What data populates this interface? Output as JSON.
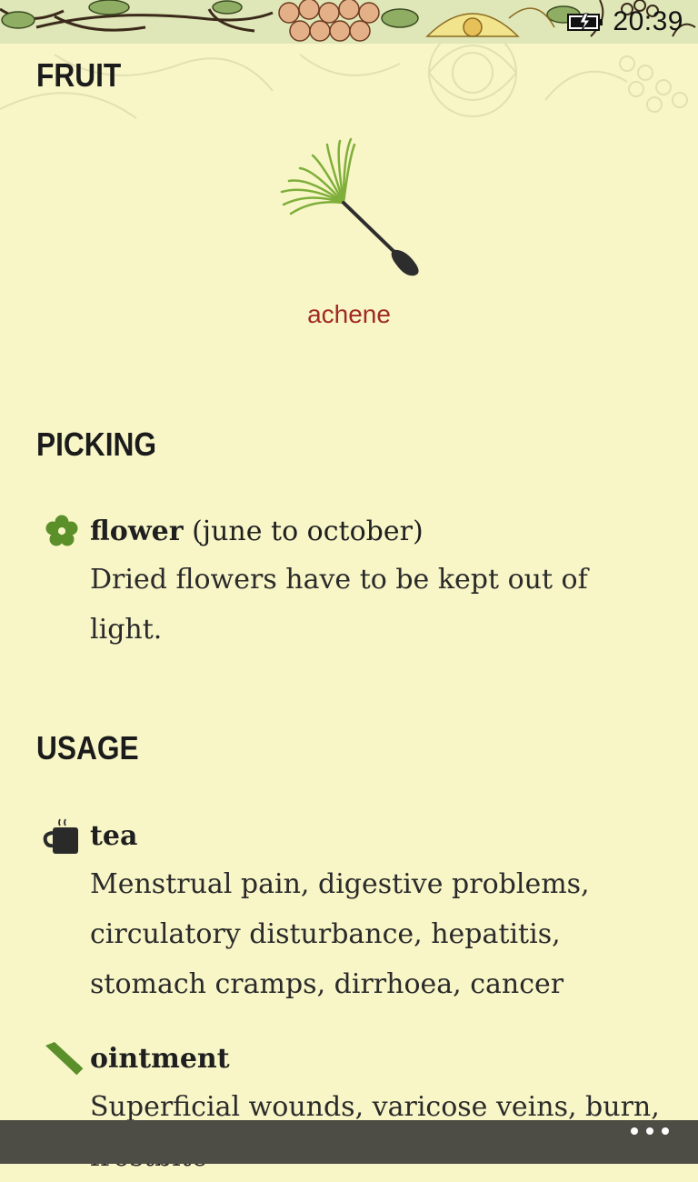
{
  "status": {
    "time": "20:39"
  },
  "page": {
    "title": "FRUIT"
  },
  "fruit": {
    "caption": "achene"
  },
  "picking": {
    "title": "PICKING",
    "items": [
      {
        "icon": "flower-icon",
        "name": "flower",
        "detail": "(june to october)",
        "text": "Dried flowers have to be kept out of light."
      }
    ]
  },
  "usage": {
    "title": "USAGE",
    "items": [
      {
        "icon": "tea-cup-icon",
        "name": "tea",
        "text": "Menstrual pain, digestive problems, circulatory disturbance, hepatitis, stomach cramps, dirrhoea, cancer"
      },
      {
        "icon": "ointment-tube-icon",
        "name": "ointment",
        "text": "Superficial wounds, varicose veins, burn, frostbite"
      }
    ]
  },
  "appbar": {
    "more_icon": "ellipsis-icon"
  },
  "colors": {
    "background": "#f8f6c7",
    "accent": "#a22a26",
    "icon_green": "#5a8f2a",
    "appbar": "#4d4d45"
  }
}
